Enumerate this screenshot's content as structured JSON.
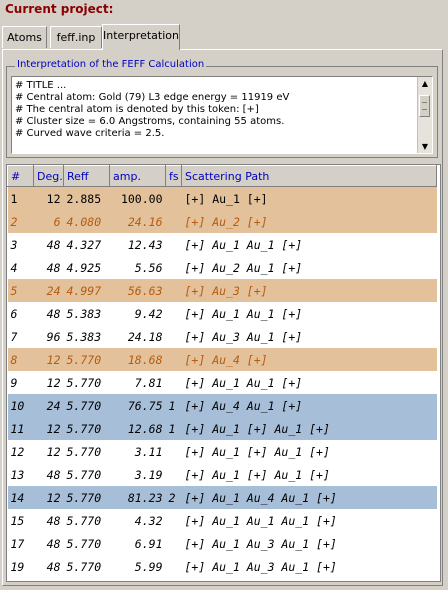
{
  "header": {
    "title": "Current project:"
  },
  "tabs": [
    {
      "label": "Atoms"
    },
    {
      "label": "feff.inp"
    },
    {
      "label": "Interpretation"
    }
  ],
  "interpretation": {
    "legend": "Interpretation of the FEFF Calculation",
    "lines": [
      "# TITLE ...",
      "# Central atom: Gold (79)  L3 edge energy = 11919 eV",
      "# The central atom is denoted by this token: [+]",
      "# Cluster size = 6.0 Angstroms, containing 55 atoms.",
      "# Curved wave criteria = 2.5."
    ]
  },
  "table": {
    "headers": [
      "#",
      "Deg.",
      "Reff",
      "amp.",
      "fs",
      "Scattering Path"
    ],
    "rows": [
      {
        "num": "1",
        "deg": "12",
        "reff": "2.885",
        "amp": "100.00",
        "fs": "",
        "path": "[+] Au_1 [+]",
        "style": "orange",
        "italic": false
      },
      {
        "num": "2",
        "deg": "6",
        "reff": "4.080",
        "amp": "24.16",
        "fs": "",
        "path": "[+] Au_2 [+]",
        "style": "orange",
        "italic": true
      },
      {
        "num": "3",
        "deg": "48",
        "reff": "4.327",
        "amp": "12.43",
        "fs": "",
        "path": "[+] Au_1 Au_1 [+]",
        "style": "",
        "italic": true
      },
      {
        "num": "4",
        "deg": "48",
        "reff": "4.925",
        "amp": "5.56",
        "fs": "",
        "path": "[+] Au_2 Au_1 [+]",
        "style": "",
        "italic": true
      },
      {
        "num": "5",
        "deg": "24",
        "reff": "4.997",
        "amp": "56.63",
        "fs": "",
        "path": "[+] Au_3 [+]",
        "style": "orange",
        "italic": true
      },
      {
        "num": "6",
        "deg": "48",
        "reff": "5.383",
        "amp": "9.42",
        "fs": "",
        "path": "[+] Au_1 Au_1 [+]",
        "style": "",
        "italic": true
      },
      {
        "num": "7",
        "deg": "96",
        "reff": "5.383",
        "amp": "24.18",
        "fs": "",
        "path": "[+] Au_3 Au_1 [+]",
        "style": "",
        "italic": true
      },
      {
        "num": "8",
        "deg": "12",
        "reff": "5.770",
        "amp": "18.68",
        "fs": "",
        "path": "[+] Au_4 [+]",
        "style": "orange",
        "italic": true
      },
      {
        "num": "9",
        "deg": "12",
        "reff": "5.770",
        "amp": "7.81",
        "fs": "",
        "path": "[+] Au_1 Au_1 [+]",
        "style": "",
        "italic": true
      },
      {
        "num": "10",
        "deg": "24",
        "reff": "5.770",
        "amp": "76.75",
        "fs": "1",
        "path": "[+] Au_4 Au_1 [+]",
        "style": "blue",
        "italic": true
      },
      {
        "num": "11",
        "deg": "12",
        "reff": "5.770",
        "amp": "12.68",
        "fs": "1",
        "path": "[+] Au_1 [+] Au_1 [+]",
        "style": "blue",
        "italic": true
      },
      {
        "num": "12",
        "deg": "12",
        "reff": "5.770",
        "amp": "3.11",
        "fs": "",
        "path": "[+] Au_1 [+] Au_1 [+]",
        "style": "",
        "italic": true
      },
      {
        "num": "13",
        "deg": "48",
        "reff": "5.770",
        "amp": "3.19",
        "fs": "",
        "path": "[+] Au_1 [+] Au_1 [+]",
        "style": "",
        "italic": true
      },
      {
        "num": "14",
        "deg": "12",
        "reff": "5.770",
        "amp": "81.23",
        "fs": "2",
        "path": "[+] Au_1 Au_4 Au_1 [+]",
        "style": "blue",
        "italic": true
      },
      {
        "num": "15",
        "deg": "48",
        "reff": "5.770",
        "amp": "4.32",
        "fs": "",
        "path": "[+] Au_1 Au_1 Au_1 [+]",
        "style": "",
        "italic": true
      },
      {
        "num": "17",
        "deg": "48",
        "reff": "5.770",
        "amp": "6.91",
        "fs": "",
        "path": "[+] Au_1 Au_3 Au_1 [+]",
        "style": "",
        "italic": true
      },
      {
        "num": "19",
        "deg": "48",
        "reff": "5.770",
        "amp": "5.99",
        "fs": "",
        "path": "[+] Au_1 Au_3 Au_1 [+]",
        "style": "",
        "italic": true
      }
    ]
  },
  "colors": {
    "title": "#8b0000",
    "legend": "#0000c0",
    "highlight_orange": "#e3c19a",
    "highlight_blue": "#a7bed8"
  }
}
